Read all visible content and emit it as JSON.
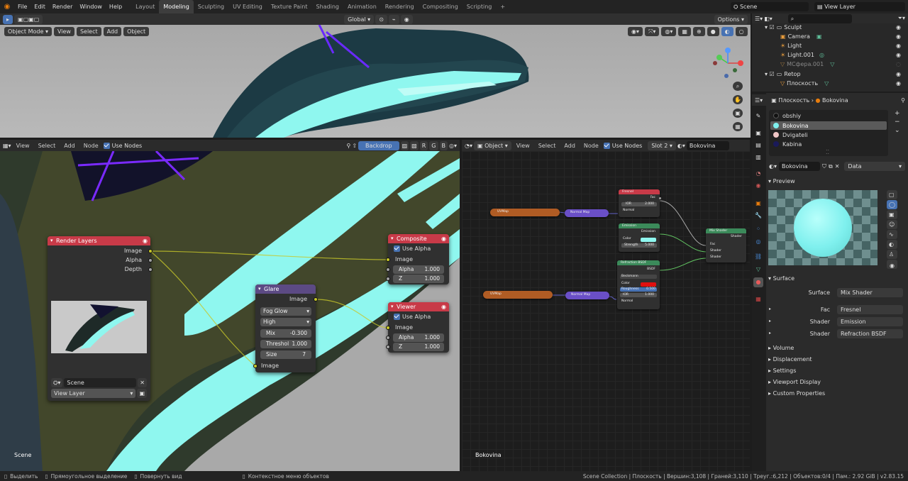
{
  "menu": [
    "File",
    "Edit",
    "Render",
    "Window",
    "Help"
  ],
  "workspaces": [
    "Layout",
    "Modeling",
    "Sculpting",
    "UV Editing",
    "Texture Paint",
    "Shading",
    "Animation",
    "Rendering",
    "Compositing",
    "Scripting"
  ],
  "active_workspace": "Modeling",
  "scene_name": "Scene",
  "view_layer": "View Layer",
  "viewport": {
    "mode": "Object Mode",
    "menus": [
      "View",
      "Select",
      "Add",
      "Object"
    ],
    "orientation": "Global",
    "options_label": "Options"
  },
  "compositor": {
    "menus": [
      "View",
      "Select",
      "Add",
      "Node"
    ],
    "use_nodes": "Use Nodes",
    "backdrop": "Backdrop",
    "channels": [
      "R",
      "G",
      "B"
    ],
    "footer": "Scene",
    "render_layers": {
      "title": "Render Layers",
      "outputs": [
        "Image",
        "Alpha",
        "Depth"
      ],
      "scene": "Scene",
      "layer": "View Layer"
    },
    "glare": {
      "title": "Glare",
      "output": "Image",
      "type": "Fog Glow",
      "quality": "High",
      "mix_label": "Mix",
      "mix": "-0.300",
      "threshold_label": "Threshol",
      "threshold": "1.000",
      "size_label": "Size",
      "size": "7",
      "input": "Image"
    },
    "composite": {
      "title": "Composite",
      "use_alpha": "Use Alpha",
      "input": "Image",
      "alpha_label": "Alpha",
      "alpha": "1.000",
      "z_label": "Z",
      "z": "1.000"
    },
    "viewer": {
      "title": "Viewer",
      "use_alpha": "Use Alpha",
      "input": "Image",
      "alpha_label": "Alpha",
      "alpha": "1.000",
      "z_label": "Z",
      "z": "1.000"
    }
  },
  "shader_editor": {
    "type": "Object",
    "menus": [
      "View",
      "Select",
      "Add",
      "Node"
    ],
    "use_nodes": "Use Nodes",
    "slot": "Slot 2",
    "material": "Bokovina",
    "footer": "Bokovina",
    "nodes": {
      "uv1": "UVMap",
      "nmap1": "Normal Map",
      "uv2": "UVMap",
      "nmap2": "Normal Map",
      "fresnel": {
        "title": "Fresnel",
        "out": "Fac",
        "ior_label": "IOR",
        "ior": "2.000",
        "normal": "Normal"
      },
      "emission": {
        "title": "Emission",
        "out": "Emission",
        "color": "Color",
        "strength_label": "Strength",
        "strength": "5.000"
      },
      "refraction": {
        "title": "Refraction BSDF",
        "out": "BSDF",
        "dist": "Beckmann",
        "color": "Color",
        "rough_label": "Roughness",
        "rough": "0.500",
        "ior_label": "IOR",
        "ior": "1.000",
        "normal": "Normal"
      },
      "mix": {
        "title": "Mix Shader",
        "out": "Shader",
        "fac": "Fac",
        "shader1": "Shader",
        "shader2": "Shader"
      }
    }
  },
  "outliner": {
    "items": [
      {
        "label": "Sculpt",
        "indent": 0
      },
      {
        "label": "Camera",
        "indent": 1
      },
      {
        "label": "Light",
        "indent": 1
      },
      {
        "label": "Light.001",
        "indent": 1
      },
      {
        "label": "МСфера.001",
        "indent": 1
      },
      {
        "label": "Retop",
        "indent": 0
      },
      {
        "label": "Плоскость",
        "indent": 1
      }
    ]
  },
  "properties": {
    "object": "Плоскость",
    "material": "Bokovina",
    "slots": [
      {
        "name": "obshiy",
        "color": "#111111"
      },
      {
        "name": "Bokovina",
        "color": "#7ff0ee"
      },
      {
        "name": "Dvigateli",
        "color": "#f0c6c6"
      },
      {
        "name": "Kabina",
        "color": "#1a1a5a"
      }
    ],
    "mat_field": "Bokovina",
    "data_label": "Data",
    "preview": "Preview",
    "surface": "Surface",
    "surface_rows": [
      {
        "label": "Surface",
        "value": "Mix Shader"
      },
      {
        "label": "Fac",
        "value": "Fresnel"
      },
      {
        "label": "Shader",
        "value": "Emission"
      },
      {
        "label": "Shader",
        "value": "Refraction BSDF"
      }
    ],
    "sections": [
      "Volume",
      "Displacement",
      "Settings",
      "Viewport Display",
      "Custom Properties"
    ]
  },
  "status": {
    "select": "Выделить",
    "box": "Прямоугольное выделение",
    "rotate": "Повернуть вид",
    "context": "Контекстное меню объектов",
    "stats": "Scene Collection | Плоскость | Вершин:3,108 | Граней:3,110 | Треуг.:6,212 | Объектов:0/4 | Пам.: 2.92 GiB | v2.83.15"
  },
  "colors": {
    "accent": "#4772b3",
    "cyan": "#8ff7ef",
    "header_red": "#c83a48",
    "header_purple": "#5c4a84",
    "header_green": "#3b8a5a"
  }
}
